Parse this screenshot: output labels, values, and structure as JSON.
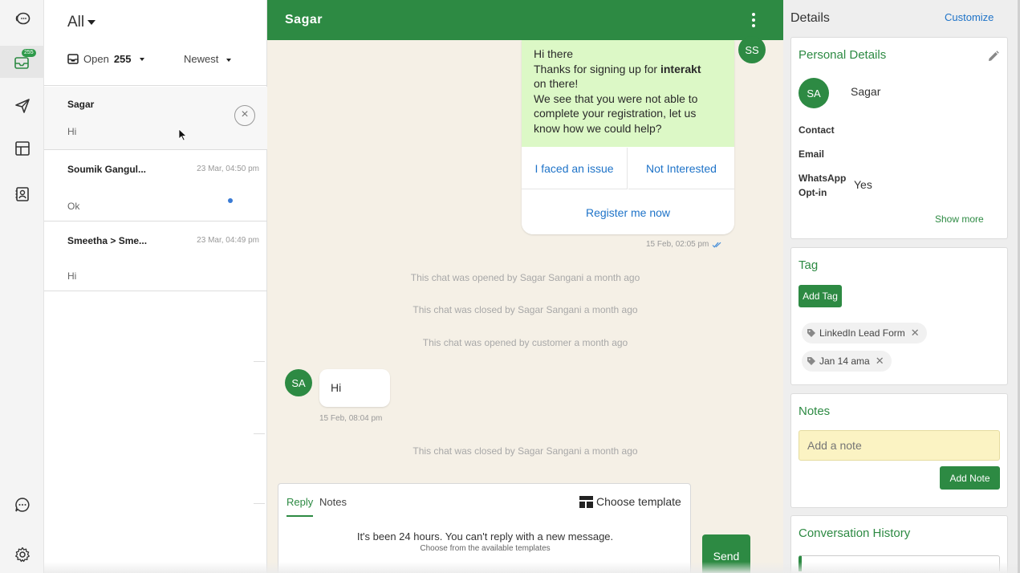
{
  "rail": {
    "items": [
      {
        "icon": "logo-icon"
      },
      {
        "icon": "inbox-icon",
        "badge": "255"
      },
      {
        "icon": "send-icon"
      },
      {
        "icon": "layout-icon"
      },
      {
        "icon": "contacts-icon"
      },
      {
        "icon": "chat-bubble-icon"
      },
      {
        "icon": "settings-icon"
      }
    ]
  },
  "list": {
    "filter_label": "All",
    "status": {
      "label": "Open",
      "count": "255"
    },
    "sort_label": "Newest",
    "conversations": [
      {
        "name": "Sagar",
        "time": "",
        "preview": "Hi"
      },
      {
        "name": "Soumik Gangul...",
        "time": "23 Mar, 04:50 pm",
        "preview": "Ok"
      },
      {
        "name": "Smeetha > Sme...",
        "time": "23 Mar, 04:49 pm",
        "preview": "Hi"
      }
    ]
  },
  "chat": {
    "title": "Sagar",
    "template_message": {
      "line1": "Hi there",
      "line2_pre": "Thanks for signing up for ",
      "line2_bold": "interakt",
      "line3": "on there!",
      "line4": "We see that you were not able to complete your registration, let us know how we could help?",
      "buttons": [
        "I faced an issue",
        "Not Interested",
        "Register me now"
      ],
      "time": "15 Feb, 02:05 pm",
      "sender_initials": "SS"
    },
    "system_messages": [
      "This chat was opened by Sagar Sangani a month ago",
      "This chat was closed by Sagar Sangani a month ago",
      "This chat was opened by customer a month ago",
      "This chat was closed by Sagar Sangani a month ago"
    ],
    "incoming": {
      "initials": "SA",
      "text": "Hi",
      "time": "15 Feb, 08:04 pm"
    },
    "composer": {
      "tab_reply": "Reply",
      "tab_notes": "Notes",
      "choose_template": "Choose template",
      "warning": "It's been 24 hours. You can't reply with a new message.",
      "subwarning": "Choose from the available templates",
      "send": "Send"
    }
  },
  "details": {
    "title": "Details",
    "customize": "Customize",
    "personal": {
      "title": "Personal Details",
      "initials": "SA",
      "name": "Sagar",
      "contact_label": "Contact",
      "email_label": "Email",
      "optin_label_1": "WhatsApp",
      "optin_label_2": "Opt-in",
      "optin_value": "Yes",
      "show_more": "Show more"
    },
    "tag": {
      "title": "Tag",
      "add_tag": "Add Tag",
      "tags": [
        "LinkedIn Lead Form",
        "Jan 14 ama"
      ]
    },
    "notes": {
      "title": "Notes",
      "placeholder": "Add a note",
      "add_note": "Add Note"
    },
    "history": {
      "title": "Conversation History"
    }
  },
  "colors": {
    "brand_green": "#2d8a43",
    "link_blue": "#1e73c8",
    "outgoing_bubble": "#dcf8c6",
    "chat_bg": "#f5f0e6"
  }
}
